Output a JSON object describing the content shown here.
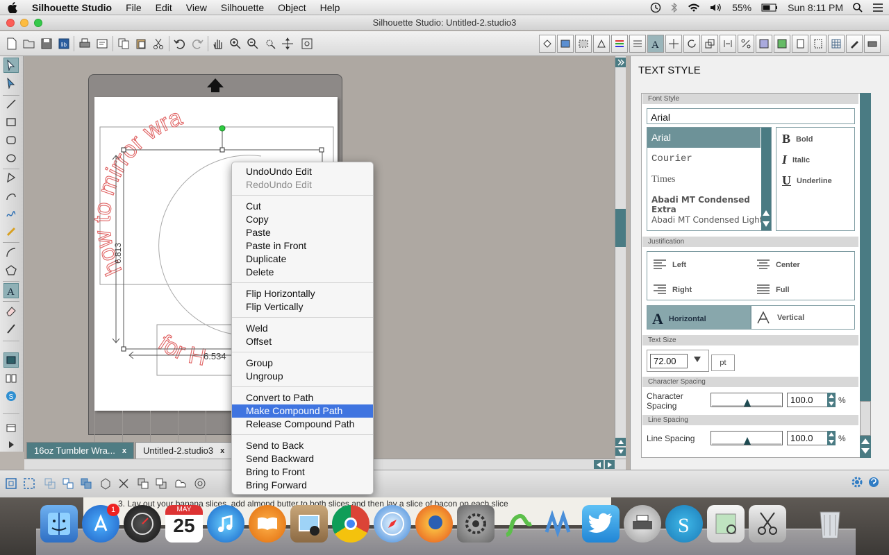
{
  "menubar": {
    "app": "Silhouette Studio",
    "items": [
      "File",
      "Edit",
      "View",
      "Silhouette",
      "Object",
      "Help"
    ],
    "battery": "55%",
    "clock": "Sun 8:11 PM"
  },
  "window": {
    "title": "Silhouette Studio: Untitled-2.studio3"
  },
  "tabs": [
    {
      "label": "16oz Tumbler Wra...",
      "close": "x"
    },
    {
      "label": "Untitled-2.studio3",
      "close": "x"
    }
  ],
  "canvas": {
    "arc_text_top": "how to mirror wra",
    "arc_text_bottom": "for H",
    "dimension_width": "6.534",
    "dimension_height": "6.813"
  },
  "context_menu": {
    "groups": [
      [
        "UndoUndo Edit",
        "RedoUndo Edit"
      ],
      [
        "Cut",
        "Copy",
        "Paste",
        "Paste in Front",
        "Duplicate",
        "Delete"
      ],
      [
        "Flip Horizontally",
        "Flip Vertically"
      ],
      [
        "Weld",
        "Offset"
      ],
      [
        "Group",
        "Ungroup"
      ],
      [
        "Convert to Path",
        "Make Compound Path",
        "Release Compound Path"
      ],
      [
        "Send to Back",
        "Send Backward",
        "Bring to Front",
        "Bring Forward"
      ]
    ],
    "disabled": [
      "RedoUndo Edit"
    ],
    "highlighted": "Make Compound Path"
  },
  "panel": {
    "title": "TEXT STYLE",
    "font_style": {
      "header": "Font Style",
      "value": "Arial",
      "fonts": [
        "Arial",
        "Courier",
        "Times",
        "Abadi MT Condensed Extra",
        "Abadi MT Condensed Light"
      ],
      "selected": "Arial",
      "styles": {
        "bold": "Bold",
        "italic": "Italic",
        "underline": "Underline"
      }
    },
    "justification": {
      "header": "Justification",
      "left": "Left",
      "center": "Center",
      "right": "Right",
      "full": "Full",
      "horizontal": "Horizontal",
      "vertical": "Vertical",
      "orientation_selected": "Horizontal"
    },
    "text_size": {
      "header": "Text Size",
      "value": "72.00",
      "unit": "pt"
    },
    "character_spacing": {
      "header": "Character Spacing",
      "label1": "Character",
      "label2": "Spacing",
      "value": "100.0",
      "unit": "%"
    },
    "line_spacing": {
      "header": "Line Spacing",
      "label": "Line Spacing",
      "value": "100.0",
      "unit": "%"
    }
  },
  "background_page": {
    "text": "3. Lay out your banana slices, add almond butter to both slices and then lay a slice of bacon on each slice"
  },
  "dock": {
    "calendar_month": "MAY",
    "calendar_day": "25",
    "app_store_badge": "1"
  },
  "icons": [
    "apple-icon",
    "time-machine-icon",
    "bluetooth-icon",
    "wifi-icon",
    "volume-icon",
    "battery-icon",
    "spotlight-icon",
    "notification-icon"
  ]
}
